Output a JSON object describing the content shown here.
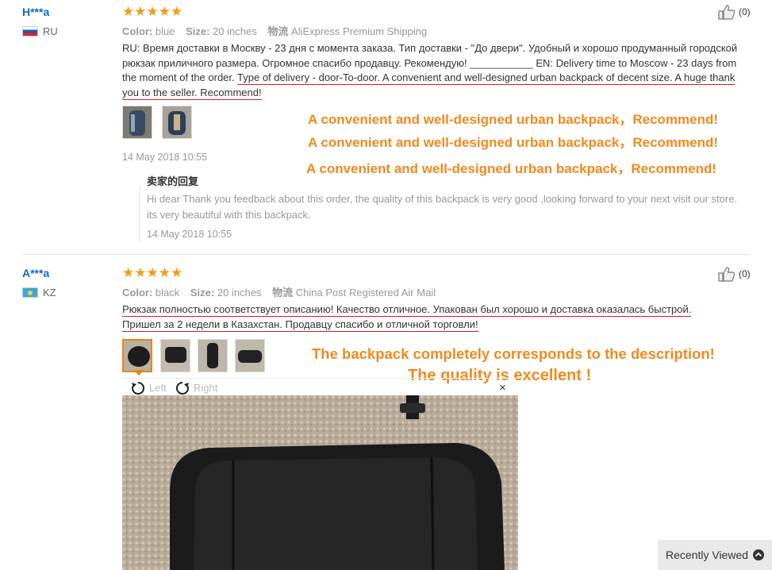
{
  "reviews": [
    {
      "user": "H***a",
      "country": "RU",
      "stars": "★★★★★",
      "color_label": "Color:",
      "color_value": "blue",
      "size_label": "Size:",
      "size_value": "20 inches",
      "ship_label": "物流",
      "ship_value": "AliExpress Premium Shipping",
      "helpful": "(0)",
      "text_plain": "RU: Время доставки в Москву - 23 дня с момента заказа. Тип доставки - \"До двери\". Удобный и хорошо продуманный городской рюкзак приличного размера. Огромное спасибо продавцу. Рекомендую! ___________ EN: Delivery time to Moscow - 23 days from the moment of the order.",
      "text_underlined": "Type of delivery - door-To-door. A convenient and well-designed urban backpack of decent size. A huge thank you to the seller. Recommend!",
      "date": "14 May 2018 10:55",
      "reply_title": "卖家的回复",
      "reply_text": "Hi dear Thank you feedback about this order, the quality of this backpack is very good ,looking forward to your next visit our store. its very beautiful with this backpack.",
      "reply_date": "14 May 2018 10:55",
      "notes": [
        "A convenient and well-designed urban backpack，Recommend!",
        "A convenient and well-designed urban backpack，Recommend!",
        "A convenient and well-designed urban backpack，Recommend!"
      ]
    },
    {
      "user": "A***a",
      "country": "KZ",
      "stars": "★★★★★",
      "color_label": "Color:",
      "color_value": "black",
      "size_label": "Size:",
      "size_value": "20 inches",
      "ship_label": "物流",
      "ship_value": "China Post Registered Air Mail",
      "helpful": "(0)",
      "text_line1": "Рюкзак полностью соответствует описанию! Качество отличное. Упакован был хорошо и доставка оказалась быстрой.",
      "text_line2": "Пришел за 2 недели в Казахстан. Продавцу спасибо и отличной торговли!",
      "notes": [
        "The backpack completely corresponds to the description!",
        "The quality is excellent !"
      ],
      "viewer": {
        "left": "Left",
        "right": "Right",
        "close": "×"
      }
    }
  ],
  "recently_viewed": "Recently Viewed",
  "colors": {
    "accent_orange": "#f08a1e",
    "underline_red": "#d91d1d",
    "name_blue": "#1166cc",
    "star": "#f39c12"
  }
}
